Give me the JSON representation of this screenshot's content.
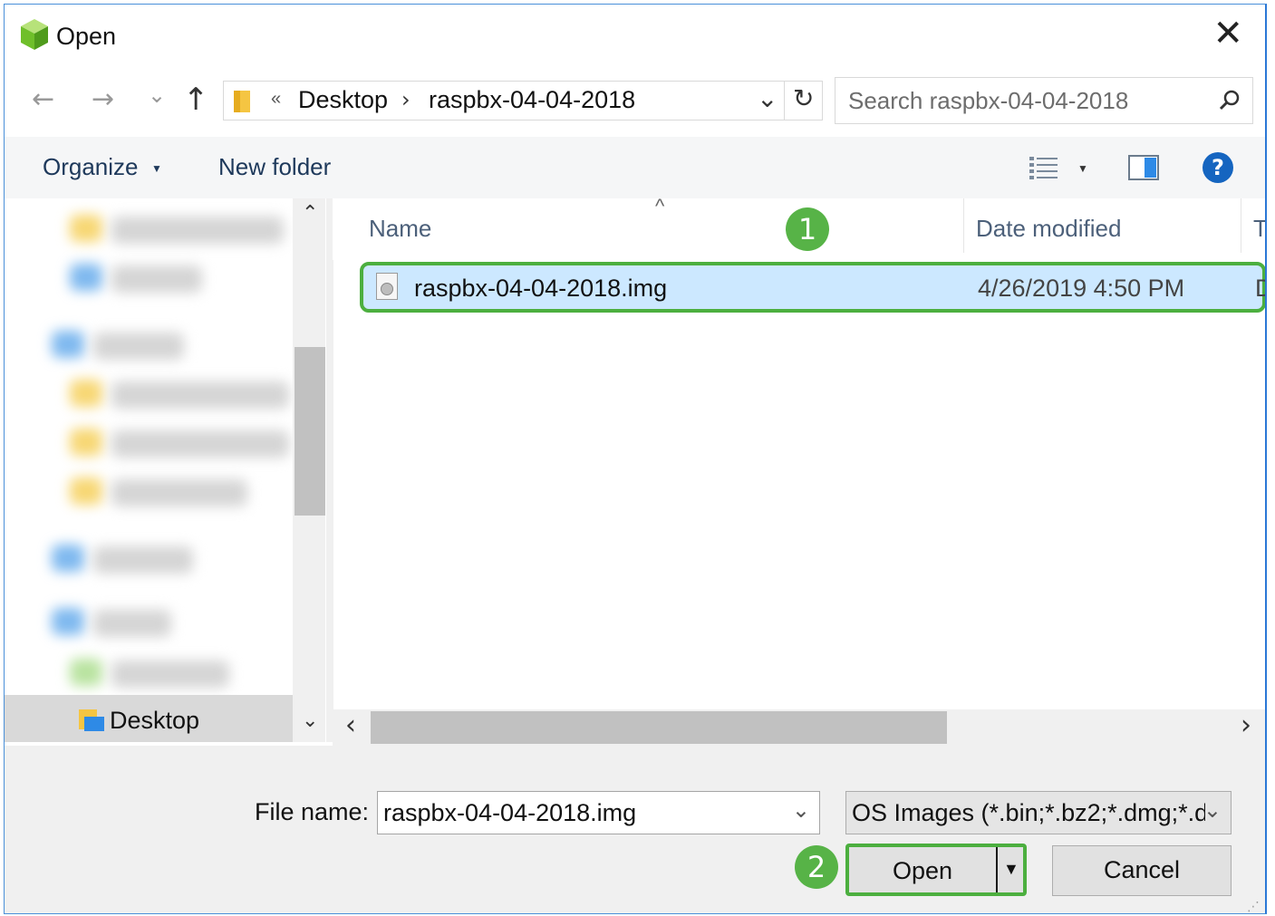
{
  "window": {
    "title": "Open",
    "close_glyph": "✕"
  },
  "nav": {
    "back": "←",
    "forward": "→",
    "recent": "⌄",
    "up": "↑"
  },
  "address": {
    "overflow": "«",
    "crumbs": [
      "Desktop",
      "raspbx-04-04-2018"
    ],
    "separator": "›",
    "dropdown": "⌄",
    "refresh": "↻"
  },
  "search": {
    "placeholder": "Search raspbx-04-04-2018",
    "icon": "search-icon"
  },
  "toolbar": {
    "organize_label": "Organize",
    "new_folder_label": "New folder",
    "help_label": "?"
  },
  "nav_pane": {
    "selected_item": "Desktop",
    "scroll_up": "⌃",
    "scroll_down": "⌄"
  },
  "file_list": {
    "sort_indicator": "^",
    "columns": [
      "Name",
      "Date modified",
      "T"
    ],
    "rows": [
      {
        "name": "raspbx-04-04-2018.img",
        "date": "4/26/2019 4:50 PM",
        "type_clip": "D"
      }
    ]
  },
  "hscroll": {
    "left": "‹",
    "right": "›"
  },
  "footer": {
    "file_name_label": "File name:",
    "file_name_value": "raspbx-04-04-2018.img",
    "filter_value": "OS Images (*.bin;*.bz2;*.dmg;*.d",
    "open_label": "Open",
    "cancel_label": "Cancel"
  },
  "annotations": {
    "step1": "1",
    "step2": "2"
  },
  "colors": {
    "accent": "#4caf3f",
    "selection": "#cce8ff",
    "help": "#1565c0"
  }
}
